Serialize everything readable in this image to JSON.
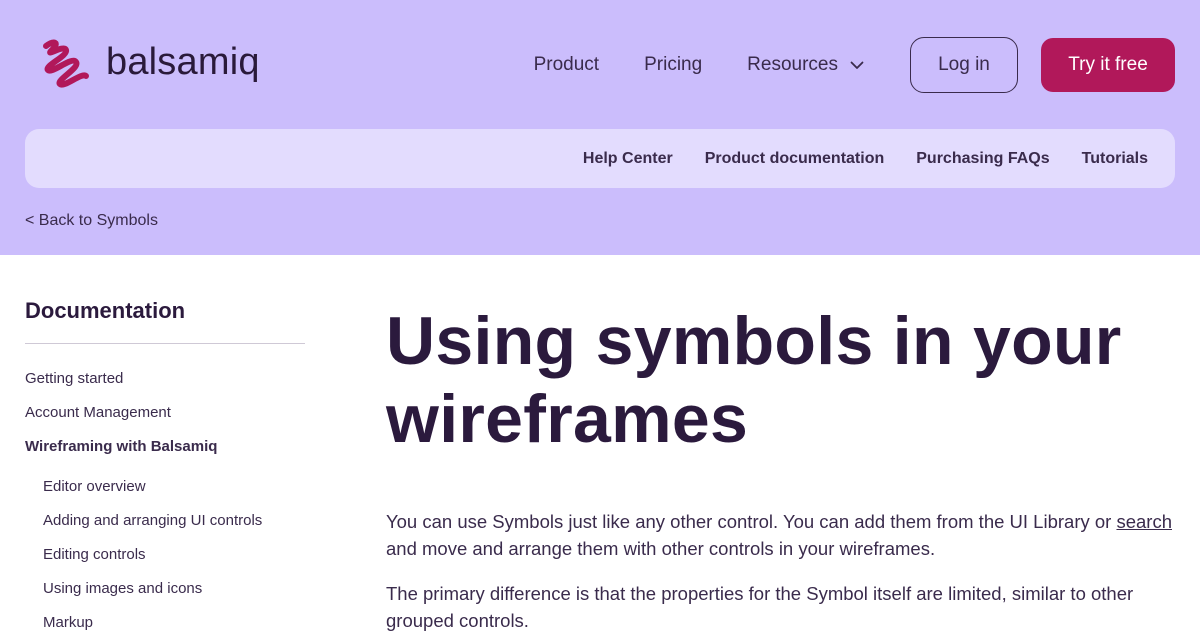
{
  "brand": {
    "name": "balsamiq",
    "accent_color": "#b1185a",
    "header_bg": "#cbbdfc",
    "subnav_bg": "#e3dcfe"
  },
  "nav": {
    "items": [
      "Product",
      "Pricing",
      "Resources"
    ],
    "resources_icon": "chevron-down-icon",
    "login_label": "Log in",
    "try_label": "Try it free"
  },
  "subnav": {
    "items": [
      "Help Center",
      "Product documentation",
      "Purchasing FAQs",
      "Tutorials"
    ]
  },
  "back_link": "< Back to Symbols",
  "sidebar": {
    "title": "Documentation",
    "items": [
      "Getting started",
      "Account Management",
      "Wireframing with Balsamiq"
    ],
    "sub_items": [
      "Editor overview",
      "Adding and arranging UI controls",
      "Editing controls",
      "Using images and icons",
      "Markup"
    ]
  },
  "main": {
    "title": "Using symbols in your wireframes",
    "para1_before": "You can use Symbols just like any other control. You can add them from the UI Library or ",
    "para1_link": "search",
    "para1_after": " and move and arrange them with other controls in your wireframes.",
    "para2": "The primary difference is that the properties for the Symbol itself are limited, similar to other grouped controls."
  }
}
